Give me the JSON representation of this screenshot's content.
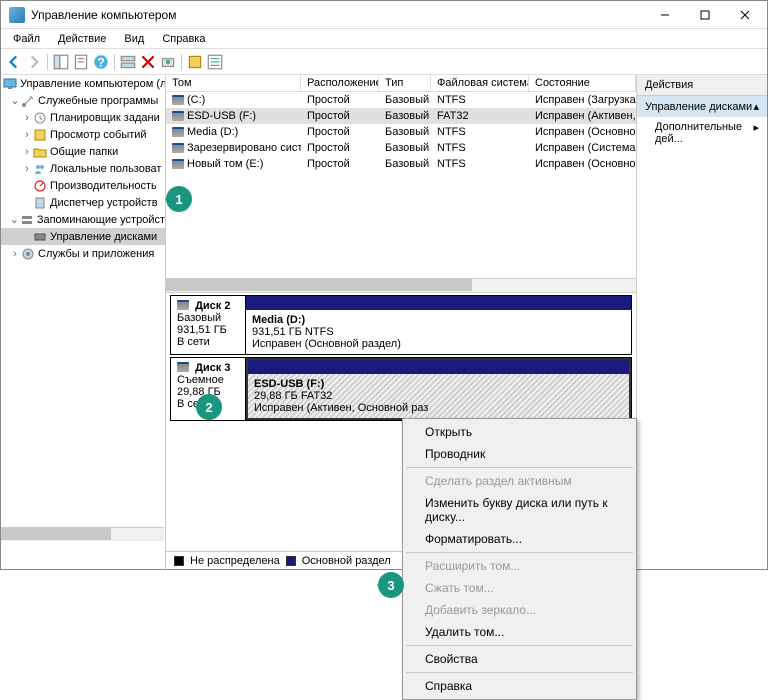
{
  "title": "Управление компьютером",
  "menu": {
    "file": "Файл",
    "action": "Действие",
    "view": "Вид",
    "help": "Справка"
  },
  "tree": {
    "root": "Управление компьютером (л",
    "system_tools": "Служебные программы",
    "scheduler": "Планировщик задани",
    "events": "Просмотр событий",
    "shared": "Общие папки",
    "users": "Локальные пользоват",
    "perf": "Производительность",
    "devmgr": "Диспетчер устройств",
    "storage": "Запоминающие устройст",
    "diskmgmt": "Управление дисками",
    "services": "Службы и приложения"
  },
  "columns": {
    "volume": "Том",
    "layout": "Расположение",
    "type": "Тип",
    "fs": "Файловая система",
    "status": "Состояние"
  },
  "volumes": [
    {
      "name": "(C:)",
      "layout": "Простой",
      "type": "Базовый",
      "fs": "NTFS",
      "status": "Исправен (Загрузка, Файл"
    },
    {
      "name": "ESD-USB (F:)",
      "layout": "Простой",
      "type": "Базовый",
      "fs": "FAT32",
      "status": "Исправен (Активен, Осно"
    },
    {
      "name": "Media (D:)",
      "layout": "Простой",
      "type": "Базовый",
      "fs": "NTFS",
      "status": "Исправен (Основной разд"
    },
    {
      "name": "Зарезервировано системой",
      "layout": "Простой",
      "type": "Базовый",
      "fs": "NTFS",
      "status": "Исправен (Система, Актив"
    },
    {
      "name": "Новый том (E:)",
      "layout": "Простой",
      "type": "Базовый",
      "fs": "NTFS",
      "status": "Исправен (Основной разд"
    }
  ],
  "disks": {
    "d2": {
      "label": "Диск 2",
      "type": "Базовый",
      "size": "931,51 ГБ",
      "state": "В сети",
      "part_name": "Media  (D:)",
      "part_info": "931,51 ГБ NTFS",
      "part_status": "Исправен (Основной раздел)"
    },
    "d3": {
      "label": "Диск 3",
      "type": "Съемное",
      "size": "29,88 ГБ",
      "state": "В сети",
      "part_name": "ESD-USB  (F:)",
      "part_info": "29,88 ГБ FAT32",
      "part_status": "Исправен (Активен, Основной раз"
    }
  },
  "legend": {
    "unalloc": "Не распределена",
    "primary": "Основной раздел"
  },
  "actions": {
    "header": "Действия",
    "section": "Управление дисками",
    "more": "Дополнительные дей..."
  },
  "ctx": {
    "open": "Открыть",
    "explorer": "Проводник",
    "active": "Сделать раздел активным",
    "letter": "Изменить букву диска или путь к диску...",
    "format": "Форматировать...",
    "extend": "Расширить том...",
    "shrink": "Сжать том...",
    "mirror": "Добавить зеркало...",
    "delete": "Удалить том...",
    "props": "Свойства",
    "help": "Справка"
  },
  "callouts": {
    "c1": "1",
    "c2": "2",
    "c3": "3"
  }
}
